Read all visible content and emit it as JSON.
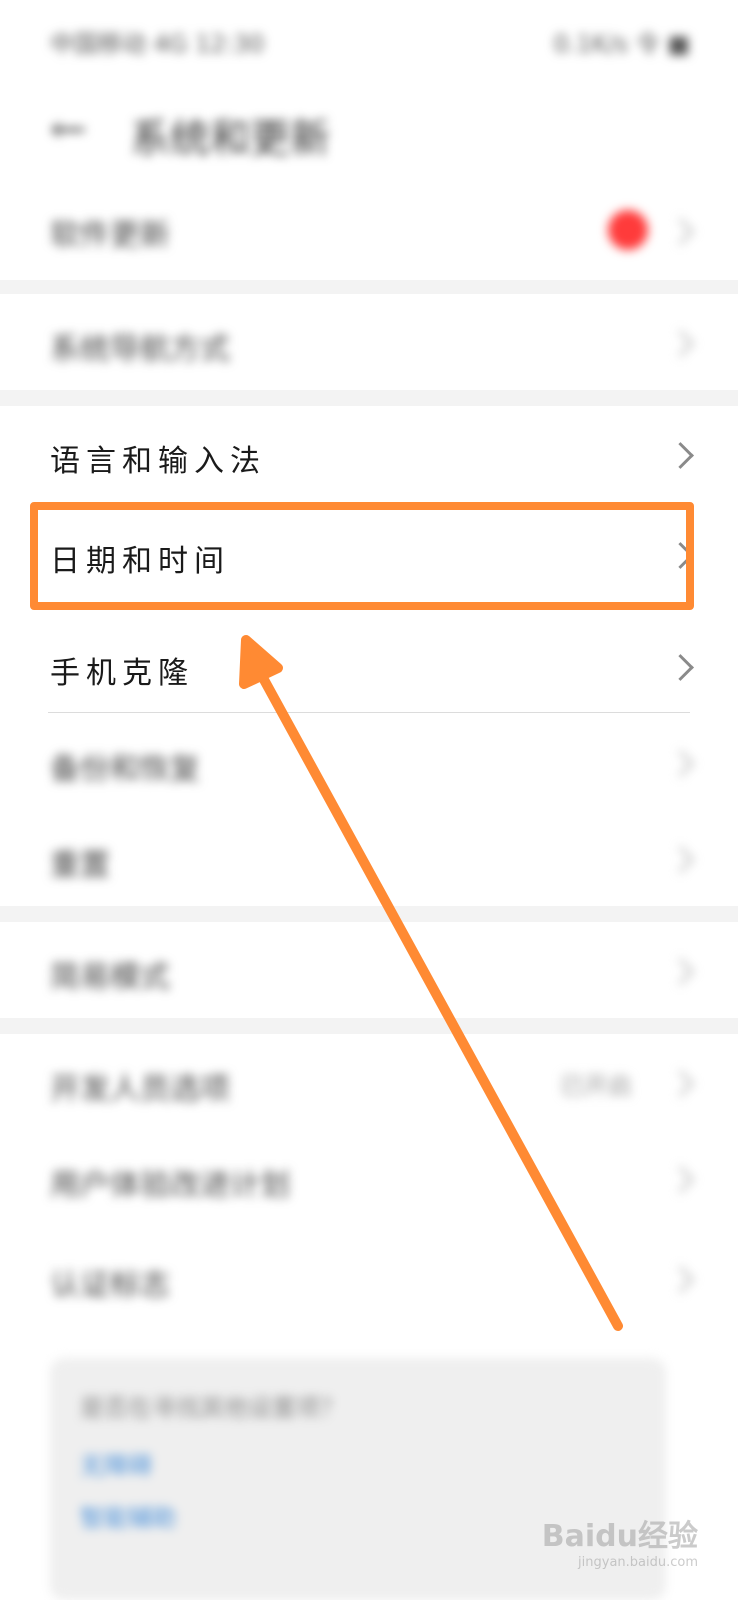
{
  "status_bar": {
    "left": "中国移动 4G 12:30",
    "right": "0.1K/s 令 ■"
  },
  "header": {
    "title": "系统和更新"
  },
  "rows": {
    "system_update": "软件更新",
    "accessibility": "系统导航方式",
    "language": "语言和输入法",
    "datetime": "日期和时间",
    "clone": "手机克隆",
    "backup": "备份和恢复",
    "reset": "重置",
    "developer": "简易模式",
    "pro_service": "开发人员选项",
    "user_exp": "用户体验改进计划",
    "certification": "认证标志",
    "pro_value": "已开启"
  },
  "tip": {
    "text": "是否在寻找其他设置项？",
    "link1": "无障碍",
    "link2": "智能辅助"
  },
  "watermark": {
    "brand": "Baidu经验",
    "url": "jingyan.baidu.com"
  },
  "colors": {
    "highlight": "#ff8a33",
    "accent": "#4a90d9",
    "red_dot": "#ff3b3b"
  }
}
